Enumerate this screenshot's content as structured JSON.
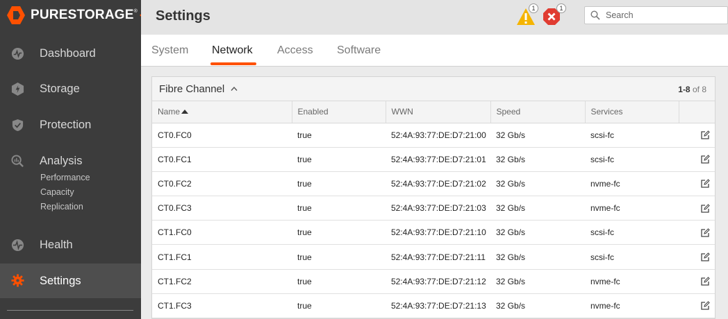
{
  "app": {
    "brand": "PURESTORAGE",
    "brand_mark": "®"
  },
  "colors": {
    "accent": "#fe5000",
    "sidebar_bg": "#3c3c3c",
    "warning": "#f5b400",
    "error": "#e03c31"
  },
  "sidebar": {
    "items": [
      {
        "label": "Dashboard",
        "icon": "dashboard-icon"
      },
      {
        "label": "Storage",
        "icon": "storage-icon"
      },
      {
        "label": "Protection",
        "icon": "shield-icon"
      },
      {
        "label": "Analysis",
        "icon": "analysis-icon",
        "subitems": [
          {
            "label": "Performance"
          },
          {
            "label": "Capacity"
          },
          {
            "label": "Replication"
          }
        ]
      },
      {
        "label": "Health",
        "icon": "health-icon"
      },
      {
        "label": "Settings",
        "icon": "gear-icon",
        "active": true
      }
    ]
  },
  "header": {
    "title": "Settings",
    "alerts": {
      "warnings": "1",
      "errors": "1"
    },
    "search": {
      "placeholder": "Search",
      "value": ""
    }
  },
  "tabs": [
    {
      "label": "System"
    },
    {
      "label": "Network",
      "active": true
    },
    {
      "label": "Access"
    },
    {
      "label": "Software"
    }
  ],
  "panel": {
    "title": "Fibre Channel",
    "pager": {
      "range": "1-8",
      "of": "of",
      "total": "8"
    },
    "columns": [
      "Name",
      "Enabled",
      "WWN",
      "Speed",
      "Services"
    ],
    "rows": [
      {
        "name": "CT0.FC0",
        "enabled": "true",
        "wwn": "52:4A:93:77:DE:D7:21:00",
        "speed": "32 Gb/s",
        "services": "scsi-fc"
      },
      {
        "name": "CT0.FC1",
        "enabled": "true",
        "wwn": "52:4A:93:77:DE:D7:21:01",
        "speed": "32 Gb/s",
        "services": "scsi-fc"
      },
      {
        "name": "CT0.FC2",
        "enabled": "true",
        "wwn": "52:4A:93:77:DE:D7:21:02",
        "speed": "32 Gb/s",
        "services": "nvme-fc"
      },
      {
        "name": "CT0.FC3",
        "enabled": "true",
        "wwn": "52:4A:93:77:DE:D7:21:03",
        "speed": "32 Gb/s",
        "services": "nvme-fc"
      },
      {
        "name": "CT1.FC0",
        "enabled": "true",
        "wwn": "52:4A:93:77:DE:D7:21:10",
        "speed": "32 Gb/s",
        "services": "scsi-fc"
      },
      {
        "name": "CT1.FC1",
        "enabled": "true",
        "wwn": "52:4A:93:77:DE:D7:21:11",
        "speed": "32 Gb/s",
        "services": "scsi-fc"
      },
      {
        "name": "CT1.FC2",
        "enabled": "true",
        "wwn": "52:4A:93:77:DE:D7:21:12",
        "speed": "32 Gb/s",
        "services": "nvme-fc"
      },
      {
        "name": "CT1.FC3",
        "enabled": "true",
        "wwn": "52:4A:93:77:DE:D7:21:13",
        "speed": "32 Gb/s",
        "services": "nvme-fc"
      }
    ]
  }
}
